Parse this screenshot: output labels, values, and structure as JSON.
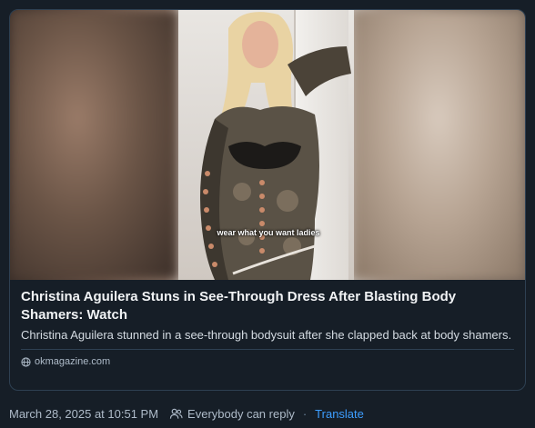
{
  "link_card": {
    "caption_overlay": "wear what you want ladies",
    "title": "Christina Aguilera Stuns in See-Through Dress After Blasting Body Shamers: Watch",
    "description": "Christina Aguilera stunned in a see-through bodysuit after she clapped back at body shamers.",
    "source_icon": "globe-icon",
    "source_domain": "okmagazine.com"
  },
  "post_meta": {
    "timestamp": "March 28, 2025 at 10:51 PM",
    "reply_icon": "people-icon",
    "reply_setting": "Everybody can reply",
    "separator": "·",
    "translate_label": "Translate"
  },
  "colors": {
    "background": "#161e27",
    "border": "#2e4052",
    "link": "#3d9eff",
    "muted": "#aebbc9"
  }
}
